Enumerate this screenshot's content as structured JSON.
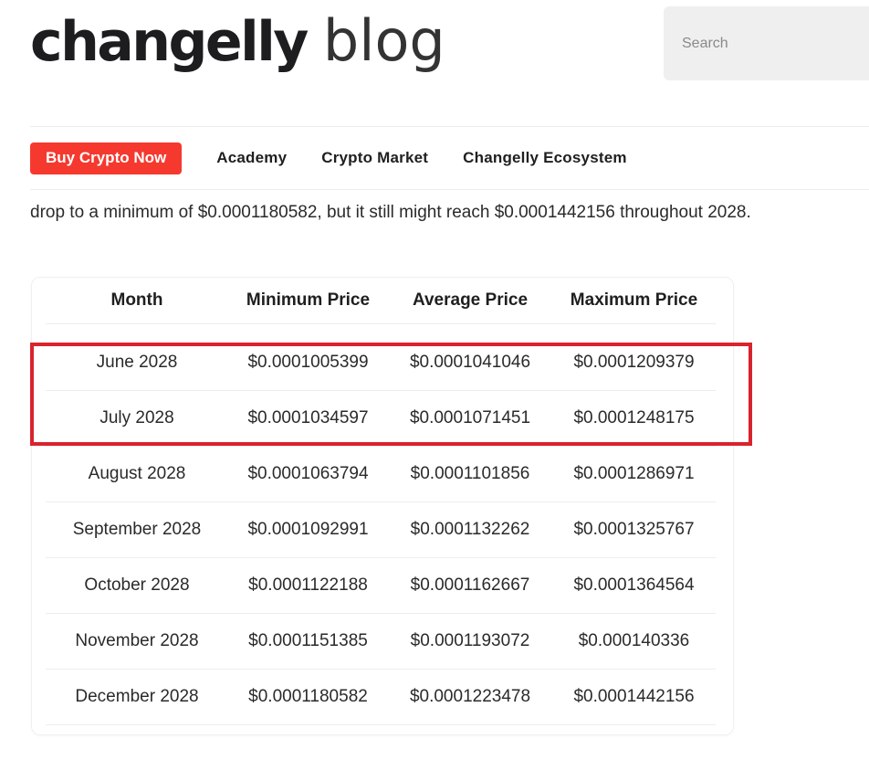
{
  "header": {
    "logo_main": "changelly",
    "logo_sub": "blog",
    "search_placeholder": "Search"
  },
  "nav": {
    "cta_label": "Buy Crypto Now",
    "links": [
      "Academy",
      "Crypto Market",
      "Changelly Ecosystem"
    ]
  },
  "colors": {
    "cta": "#f5392e",
    "highlight_box": "#d9232d"
  },
  "article": {
    "intro_text": "drop to a minimum of $0.0001180582, but it still might reach $0.0001442156 throughout 2028."
  },
  "price_table": {
    "headers": [
      "Month",
      "Minimum Price",
      "Average Price",
      "Maximum Price"
    ],
    "rows": [
      {
        "month": "June 2028",
        "min": "$0.0001005399",
        "avg": "$0.0001041046",
        "max": "$0.0001209379"
      },
      {
        "month": "July 2028",
        "min": "$0.0001034597",
        "avg": "$0.0001071451",
        "max": "$0.0001248175"
      },
      {
        "month": "August 2028",
        "min": "$0.0001063794",
        "avg": "$0.0001101856",
        "max": "$0.0001286971"
      },
      {
        "month": "September 2028",
        "min": "$0.0001092991",
        "avg": "$0.0001132262",
        "max": "$0.0001325767"
      },
      {
        "month": "October 2028",
        "min": "$0.0001122188",
        "avg": "$0.0001162667",
        "max": "$0.0001364564"
      },
      {
        "month": "November 2028",
        "min": "$0.0001151385",
        "avg": "$0.0001193072",
        "max": "$0.000140336"
      },
      {
        "month": "December 2028",
        "min": "$0.0001180582",
        "avg": "$0.0001223478",
        "max": "$0.0001442156"
      }
    ],
    "highlighted_rows": [
      "June 2028",
      "July 2028"
    ]
  }
}
